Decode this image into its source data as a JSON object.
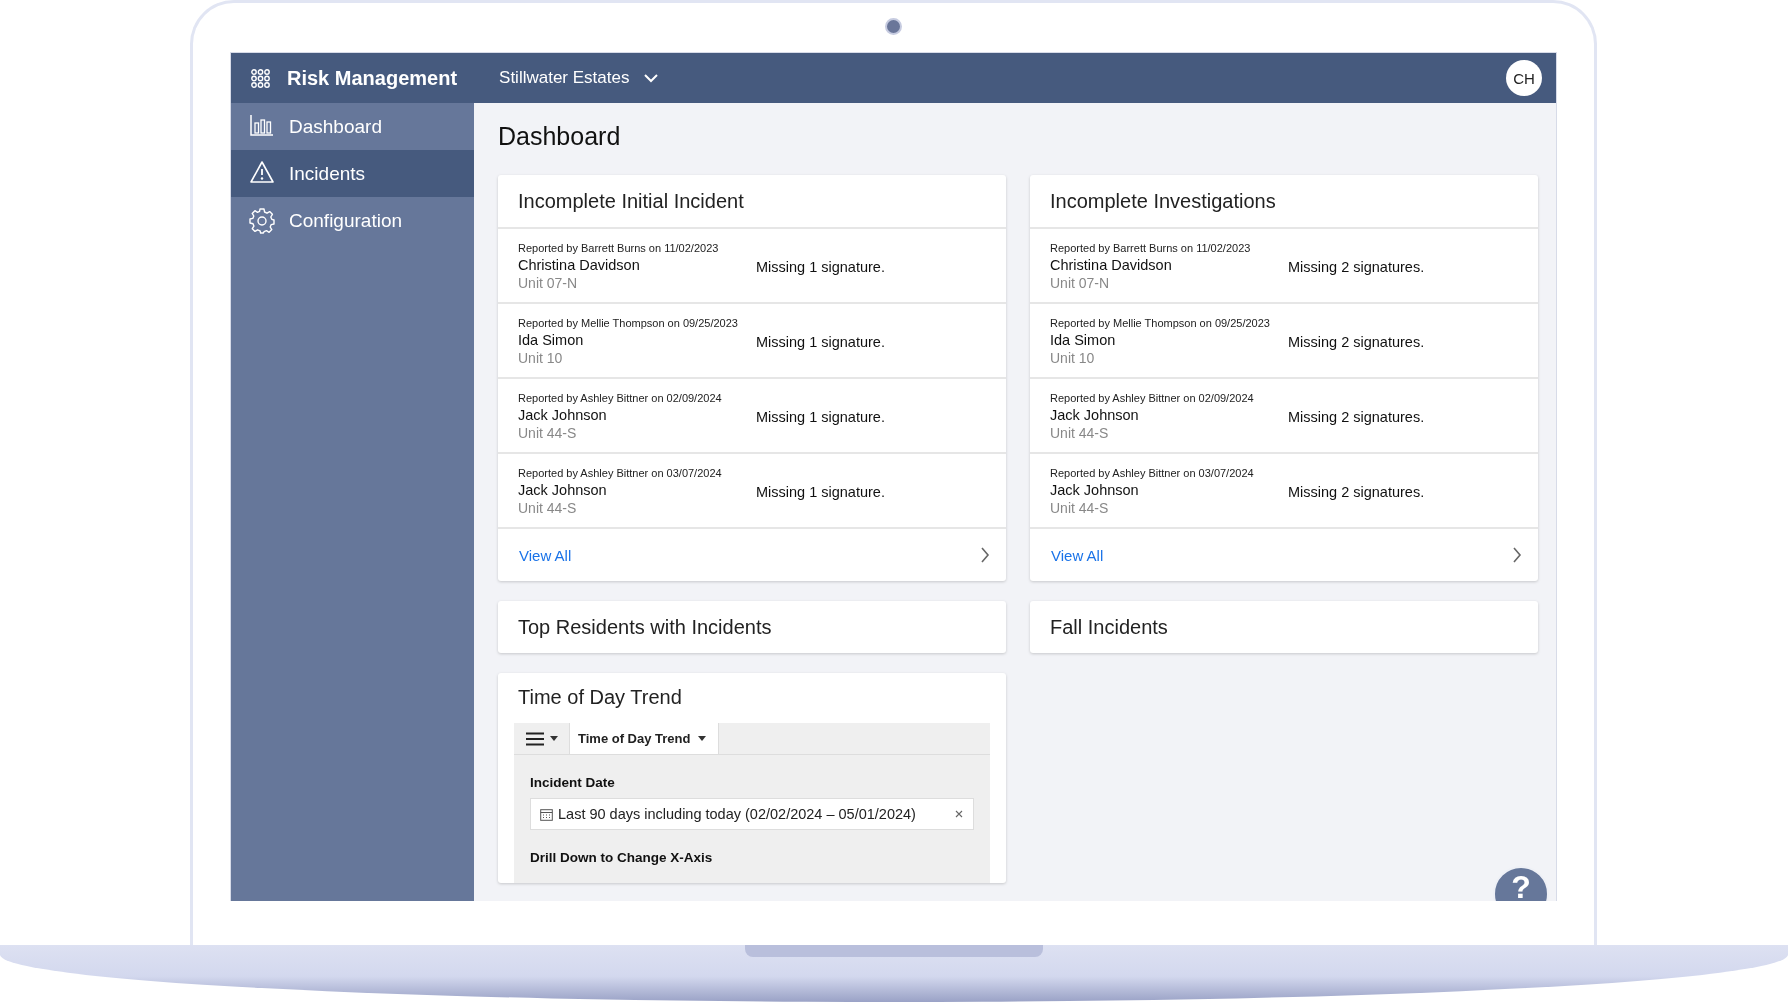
{
  "app": {
    "title": "Risk Management",
    "facility": "Stillwater Estates",
    "user_initials": "CH"
  },
  "sidebar": {
    "items": [
      {
        "label": "Dashboard",
        "selected": false
      },
      {
        "label": "Incidents",
        "selected": true
      },
      {
        "label": "Configuration",
        "selected": false
      }
    ]
  },
  "page_title": "Dashboard",
  "cards": [
    {
      "title": "Incomplete Initial Incident",
      "link": "View All",
      "rows": [
        {
          "reported": "Reported by Barrett Burns on 11/02/2023",
          "resident": "Christina Davidson",
          "unit": "Unit 07-N",
          "status": "Missing 1 signature."
        },
        {
          "reported": "Reported by Mellie Thompson on 09/25/2023",
          "resident": "Ida Simon",
          "unit": "Unit 10",
          "status": "Missing 1 signature."
        },
        {
          "reported": "Reported by Ashley Bittner on 02/09/2024",
          "resident": "Jack Johnson",
          "unit": "Unit 44-S",
          "status": "Missing 1 signature."
        },
        {
          "reported": "Reported by Ashley Bittner on 03/07/2024",
          "resident": "Jack Johnson",
          "unit": "Unit 44-S",
          "status": "Missing 1 signature."
        }
      ]
    },
    {
      "title": "Incomplete Investigations",
      "link": "View All",
      "rows": [
        {
          "reported": "Reported by Barrett Burns on 11/02/2023",
          "resident": "Christina Davidson",
          "unit": "Unit 07-N",
          "status": "Missing 2 signatures."
        },
        {
          "reported": "Reported by Mellie Thompson on 09/25/2023",
          "resident": "Ida Simon",
          "unit": "Unit 10",
          "status": "Missing 2 signatures."
        },
        {
          "reported": "Reported by Ashley Bittner on 02/09/2024",
          "resident": "Jack Johnson",
          "unit": "Unit 44-S",
          "status": "Missing 2 signatures."
        },
        {
          "reported": "Reported by Ashley Bittner on 03/07/2024",
          "resident": "Jack Johnson",
          "unit": "Unit 44-S",
          "status": "Missing 2 signatures."
        }
      ]
    }
  ],
  "panels": [
    {
      "title": "Top Residents with Incidents"
    },
    {
      "title": "Fall Incidents"
    }
  ],
  "trend": {
    "title": "Time of Day Trend",
    "tab": "Time of Day Trend",
    "filter_label": "Incident Date",
    "date_range": "Last 90 days including today (02/02/2024 – 05/01/2024)",
    "drill_label": "Drill Down to Change X-Axis"
  },
  "help": "?"
}
